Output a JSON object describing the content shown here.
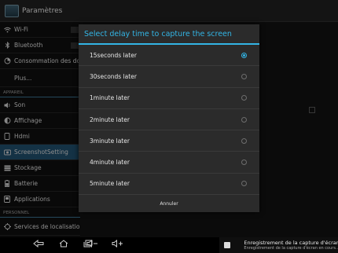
{
  "app": {
    "title": "Paramètres"
  },
  "sidebar": {
    "items": [
      {
        "label": "Wi-Fi",
        "icon": "wifi-icon"
      },
      {
        "label": "Bluetooth",
        "icon": "bluetooth-icon"
      },
      {
        "label": "Consommation des donn",
        "icon": "data-usage-icon"
      },
      {
        "label": "Plus...",
        "icon": ""
      }
    ],
    "section_appareil": "APPAREIL",
    "device_items": [
      {
        "label": "Son",
        "icon": "sound-icon"
      },
      {
        "label": "Affichage",
        "icon": "display-icon"
      },
      {
        "label": "Hdmi",
        "icon": "hdmi-icon"
      },
      {
        "label": "ScreenshotSetting",
        "icon": "screenshot-icon",
        "active": true
      },
      {
        "label": "Stockage",
        "icon": "storage-icon"
      },
      {
        "label": "Batterie",
        "icon": "battery-icon"
      },
      {
        "label": "Applications",
        "icon": "applications-icon"
      }
    ],
    "section_personnel": "PERSONNEL",
    "personal_items": [
      {
        "label": "Services de localisation",
        "icon": "location-icon"
      }
    ]
  },
  "dialog": {
    "title": "Select delay time to capture the screen",
    "options": [
      {
        "label": "15seconds later",
        "selected": true
      },
      {
        "label": "30seconds later",
        "selected": false
      },
      {
        "label": "1minute later",
        "selected": false
      },
      {
        "label": "2minute later",
        "selected": false
      },
      {
        "label": "3minute later",
        "selected": false
      },
      {
        "label": "4minute later",
        "selected": false
      },
      {
        "label": "5minute later",
        "selected": false
      }
    ],
    "cancel_label": "Annuler"
  },
  "navbar": {
    "back": "◁",
    "home": "⌂",
    "recent": "▭",
    "vol_down": "◁−",
    "vol_up": "◁+"
  },
  "notification": {
    "title": "Enregistrement de la capture d'écran...",
    "subtitle": "Enregistrement de la capture d'écran en cours..."
  },
  "colors": {
    "accent": "#33b5e5",
    "active_item": "#1f4d6b"
  }
}
